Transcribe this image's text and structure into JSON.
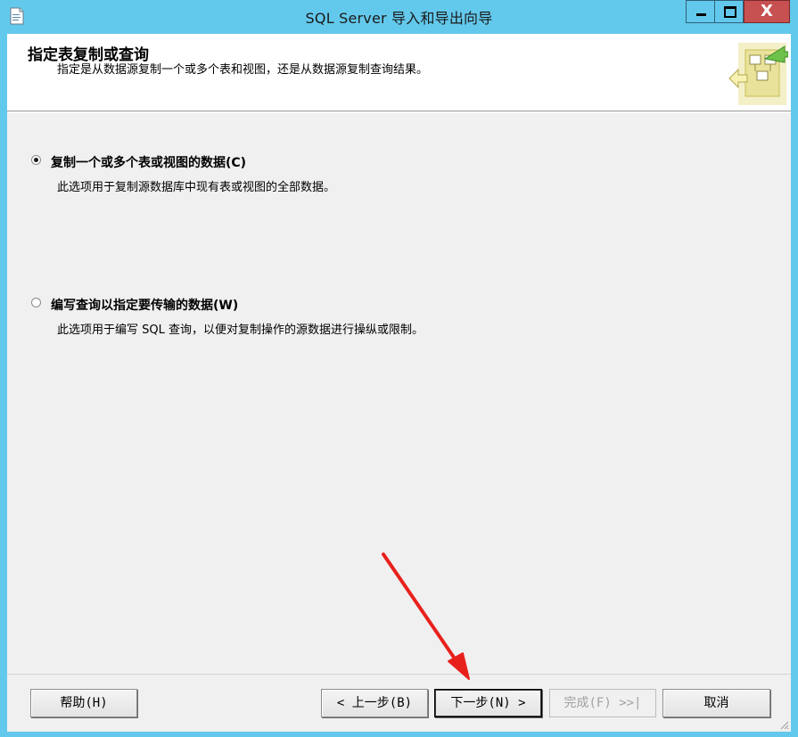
{
  "window": {
    "title": "SQL Server 导入和导出向导",
    "close_glyph": "X"
  },
  "header": {
    "title": "指定表复制或查询",
    "subtitle": "指定是从数据源复制一个或多个表和视图，还是从数据源复制查询结果。"
  },
  "options": [
    {
      "label": "复制一个或多个表或视图的数据(C)",
      "description": "此选项用于复制源数据库中现有表或视图的全部数据。",
      "selected": true
    },
    {
      "label": "编写查询以指定要传输的数据(W)",
      "description": "此选项用于编写 SQL 查询，以便对复制操作的源数据进行操纵或限制。",
      "selected": false
    }
  ],
  "buttons": {
    "help": "帮助(H)",
    "back": "< 上一步(B)",
    "next": "下一步(N) >",
    "finish": "完成(F) >>|",
    "cancel": "取消"
  },
  "colors": {
    "titlebar": "#63c9ec",
    "close": "#c75050",
    "annotation_arrow": "#e8201c"
  },
  "icons": {
    "app": "document-icon",
    "header": "wizard-graphic-icon"
  }
}
